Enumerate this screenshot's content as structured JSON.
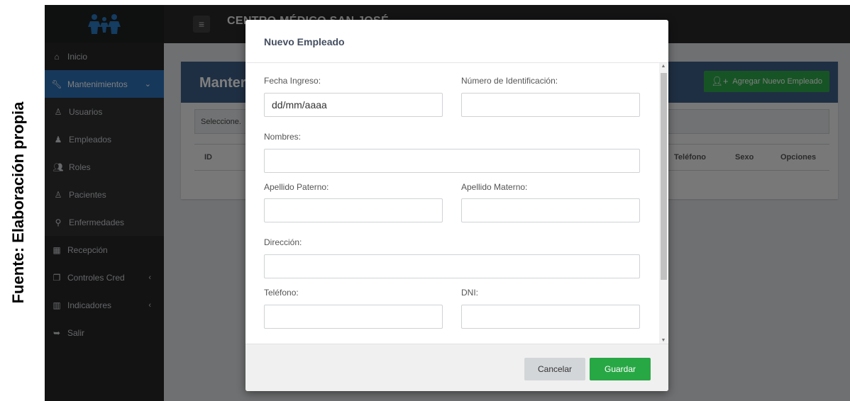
{
  "caption": "Fuente: Elaboración propia",
  "app": {
    "brand": "CENTRO MÉDICO SAN JOSÉ",
    "menu_icon": "hamburger-icon",
    "logo_icon": "family-logo-icon"
  },
  "sidebar": {
    "items": [
      {
        "label": "Inicio",
        "icon": "home-icon"
      },
      {
        "label": "Mantenimientos",
        "icon": "wrench-icon",
        "active": true
      },
      {
        "label": "Usuarios",
        "icon": "user-icon"
      },
      {
        "label": "Empleados",
        "icon": "employees-icon"
      },
      {
        "label": "Roles",
        "icon": "users-icon"
      },
      {
        "label": "Pacientes",
        "icon": "user-icon"
      },
      {
        "label": "Enfermedades",
        "icon": "search-icon"
      },
      {
        "label": "Recepción",
        "icon": "building-icon"
      },
      {
        "label": "Controles Cred",
        "icon": "copy-icon"
      },
      {
        "label": "Indicadores",
        "icon": "bar-chart-icon"
      },
      {
        "label": "Salir",
        "icon": "sign-out-icon"
      }
    ]
  },
  "page": {
    "title_visible": "Manter",
    "add_button": "Agregar Nuevo Empleado",
    "select_placeholder": "Seleccione.",
    "columns": {
      "id": "ID",
      "phone": "Teléfono",
      "sex": "Sexo",
      "options": "Opciones"
    }
  },
  "modal": {
    "title": "Nuevo Empleado",
    "fields": {
      "fecha_label": "Fecha Ingreso:",
      "fecha_value": "dd/mm/aaaa",
      "numero_label": "Número de Identificación:",
      "nombres_label": "Nombres:",
      "ap_paterno_label": "Apellido Paterno:",
      "ap_materno_label": "Apellido Materno:",
      "direccion_label": "Dirección:",
      "telefono_label": "Teléfono:",
      "dni_label": "DNI:"
    },
    "cancel": "Cancelar",
    "save": "Guardar"
  },
  "colors": {
    "primary": "#2c71b6",
    "header": "#3f5f86",
    "success": "#28a745",
    "sidebar": "#262728"
  }
}
